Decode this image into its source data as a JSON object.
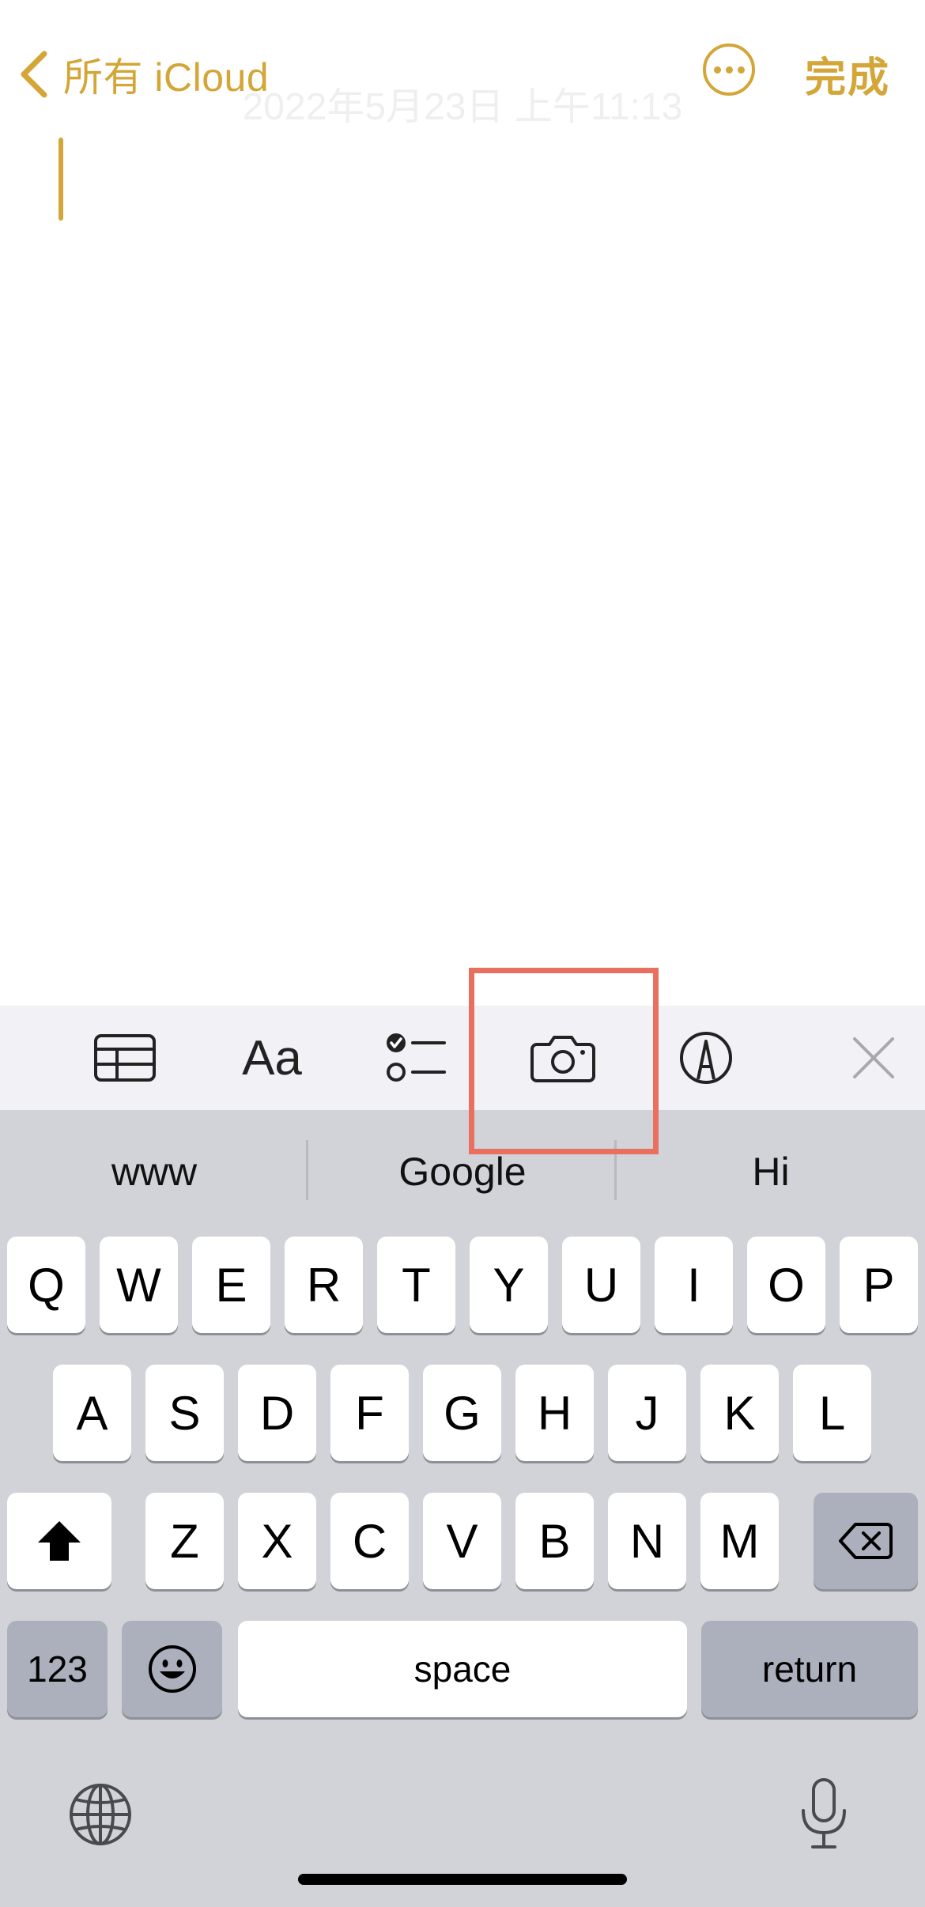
{
  "header": {
    "back_label": "所有 iCloud",
    "timestamp": "2022年5月23日 上午11:13",
    "done_label": "完成"
  },
  "toolbar": {
    "icons": [
      "table-icon",
      "text-format-icon",
      "checklist-icon",
      "camera-icon",
      "markup-icon",
      "close-icon"
    ],
    "text_style_label": "Aa",
    "highlighted_tool": "camera-icon"
  },
  "suggestions": [
    "www",
    "Google",
    "Hi"
  ],
  "keyboard": {
    "row1": [
      "Q",
      "W",
      "E",
      "R",
      "T",
      "Y",
      "U",
      "I",
      "O",
      "P"
    ],
    "row2": [
      "A",
      "S",
      "D",
      "F",
      "G",
      "H",
      "J",
      "K",
      "L"
    ],
    "row3": [
      "Z",
      "X",
      "C",
      "V",
      "B",
      "N",
      "M"
    ],
    "numbers_label": "123",
    "space_label": "space",
    "return_label": "return"
  },
  "colors": {
    "accent": "#D4A537",
    "highlight_box": "#E9705F",
    "toolbar_bg": "#F2F2F6",
    "keyboard_bg": "#D1D3D9",
    "key_dark": "#ABB0BC"
  }
}
